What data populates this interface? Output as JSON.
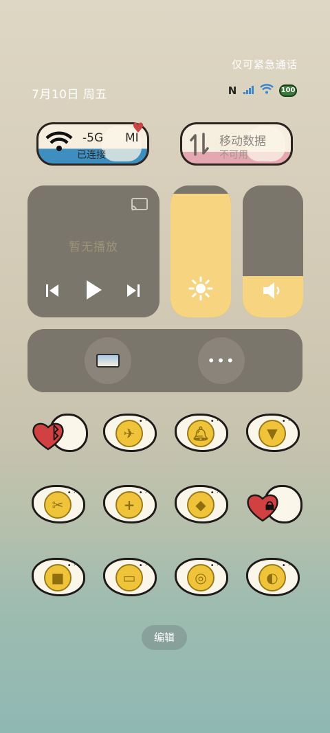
{
  "header": {
    "emergency_text": "仅可紧急通话",
    "date_text": "7月10日 周五",
    "battery_level": "100"
  },
  "wifi_tile": {
    "name": "-5G",
    "extra": "MI",
    "status": "已连接",
    "accent": "#3f8ec0"
  },
  "data_tile": {
    "label": "移动数据",
    "status": "不可用",
    "accent": "#e6a8b0"
  },
  "media": {
    "empty_text": "暂无播放"
  },
  "sliders": {
    "brightness_level": 0.94,
    "volume_level": 0.31,
    "fill_color": "#f7d580"
  },
  "toggles": [
    {
      "name": "bluetooth-icon",
      "style": "heart"
    },
    {
      "name": "airplane-mode-icon",
      "style": "egg"
    },
    {
      "name": "bell-icon",
      "style": "egg"
    },
    {
      "name": "flashlight-icon",
      "style": "egg"
    },
    {
      "name": "screenshot-cut-icon",
      "style": "egg"
    },
    {
      "name": "battery-saver-icon",
      "style": "egg"
    },
    {
      "name": "location-icon",
      "style": "egg"
    },
    {
      "name": "rotation-lock-icon",
      "style": "heart"
    },
    {
      "name": "video-record-icon",
      "style": "egg"
    },
    {
      "name": "screen-mode-icon",
      "style": "egg"
    },
    {
      "name": "focus-mode-icon",
      "style": "egg"
    },
    {
      "name": "contrast-icon",
      "style": "egg"
    }
  ],
  "footer": {
    "edit_label": "编辑"
  }
}
